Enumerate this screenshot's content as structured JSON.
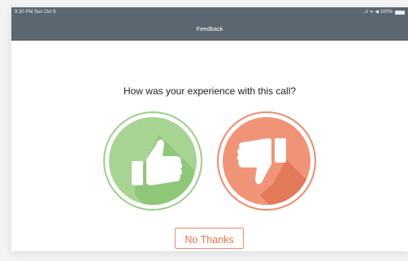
{
  "status_bar": {
    "time": "9:30 PM  Sun Oct 6",
    "signal": "..ıl ᯤ ◀ 100%"
  },
  "nav": {
    "title": "Feedback"
  },
  "main": {
    "question": "How was your experience with this call?",
    "thumbs_up_icon": "thumbs-up-icon",
    "thumbs_down_icon": "thumbs-down-icon",
    "no_thanks_label": "No Thanks"
  },
  "colors": {
    "status_bar": "#5b6670",
    "positive": "#9ccf87",
    "negative": "#ef8a6a"
  }
}
